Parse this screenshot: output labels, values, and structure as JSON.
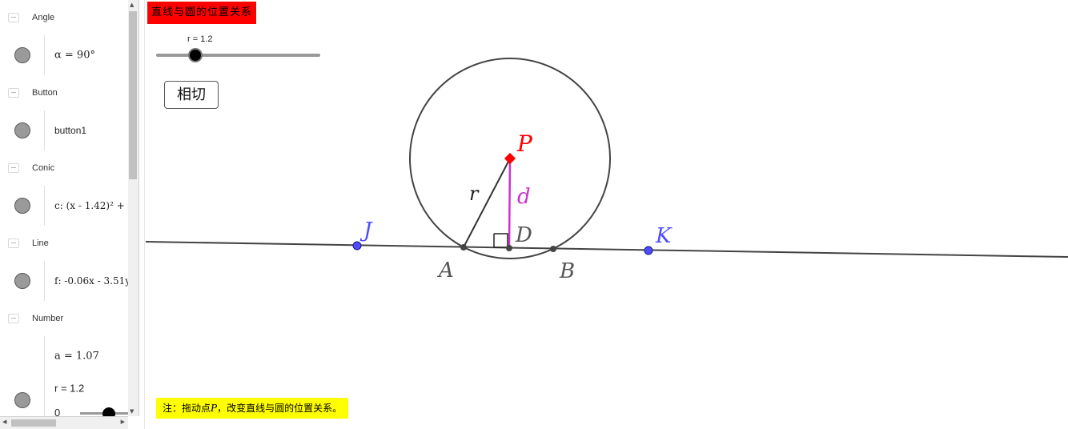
{
  "algebra": {
    "groups": [
      {
        "label": "Angle",
        "items": [
          {
            "value": "α = 90°"
          }
        ]
      },
      {
        "label": "Button",
        "items": [
          {
            "value": "button1"
          }
        ]
      },
      {
        "label": "Conic",
        "items": [
          {
            "value": "c: (x - 1.42)² + "
          }
        ]
      },
      {
        "label": "Line",
        "items": [
          {
            "value": "f: -0.06x - 3.51y"
          }
        ]
      },
      {
        "label": "Number",
        "items": [
          {
            "value": "a = 1.07"
          },
          {
            "value": "r = 1.2",
            "slider_min": "0",
            "slider_value": 1.2
          }
        ]
      }
    ]
  },
  "graphics": {
    "title": "直线与圆的位置关系",
    "button_label": "相切",
    "note_prefix": "注：拖动点",
    "note_var": "P",
    "note_suffix": "，改变直线与圆的位置关系。",
    "slider": {
      "label": "r = 1.2",
      "value": 1.2,
      "min": 0,
      "max": 5
    },
    "points": {
      "P": "P",
      "J": "J",
      "K": "K",
      "A": "A",
      "B": "B",
      "D": "D"
    },
    "segment_labels": {
      "r": "r",
      "d": "d"
    },
    "colors": {
      "title_bg": "#ff0000",
      "note_bg": "#ffff00",
      "point_P": "#ff0000",
      "points_JK": "#4d4dff",
      "segment_d": "#cc33cc",
      "stroke": "#444444"
    }
  }
}
